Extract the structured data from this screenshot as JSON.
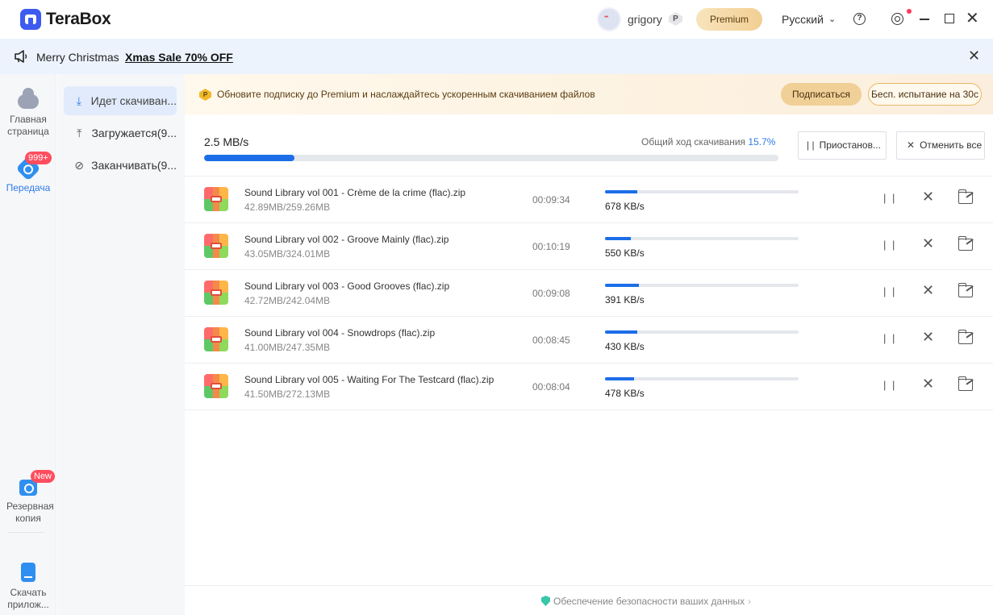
{
  "app": {
    "name": "TeraBox"
  },
  "header": {
    "username": "grigory",
    "premium_badge": "P",
    "premium_button": "Premium",
    "language": "Русский",
    "help_icon": "?"
  },
  "promo": {
    "text": "Merry Christmas",
    "link": "Xmas Sale 70% OFF"
  },
  "leftnav": {
    "home": "Главная страница",
    "transfer": "Передача",
    "transfer_badge": "999+",
    "backup": "Резервная копия",
    "backup_badge": "New",
    "download_app": "Скачать прилож..."
  },
  "subnav": {
    "downloading": "Идет скачиван...",
    "uploading": "Загружается(9...",
    "finished": "Заканчивать(9..."
  },
  "upgrade": {
    "badge": "P",
    "text": "Обновите подписку до Premium и наслаждайтесь ускоренным скачиванием файлов",
    "subscribe": "Подписаться",
    "trial": "Бесп. испытание на 30с"
  },
  "overall": {
    "speed": "2.5 MB/s",
    "label": "Общий ход скачивания",
    "percent_text": "15.7%",
    "progress": 0.157,
    "pause_all": "Приостанов...",
    "cancel_all": "Отменить все"
  },
  "downloads": [
    {
      "name": "Sound Library vol 001 - Crème de la crime (flac).zip",
      "size": "42.89MB/259.26MB",
      "eta": "00:09:34",
      "speed": "678 KB/s",
      "progress": 0.165
    },
    {
      "name": "Sound Library vol 002 - Groove Mainly (flac).zip",
      "size": "43.05MB/324.01MB",
      "eta": "00:10:19",
      "speed": "550 KB/s",
      "progress": 0.133
    },
    {
      "name": "Sound Library vol 003 - Good Grooves (flac).zip",
      "size": "42.72MB/242.04MB",
      "eta": "00:09:08",
      "speed": "391 KB/s",
      "progress": 0.176
    },
    {
      "name": "Sound Library vol 004 - Snowdrops (flac).zip",
      "size": "41.00MB/247.35MB",
      "eta": "00:08:45",
      "speed": "430 KB/s",
      "progress": 0.166
    },
    {
      "name": "Sound Library vol 005 - Waiting For The Testcard (flac).zip",
      "size": "41.50MB/272.13MB",
      "eta": "00:08:04",
      "speed": "478 KB/s",
      "progress": 0.152
    }
  ],
  "footer": {
    "text": "Обеспечение безопасности ваших данных"
  }
}
